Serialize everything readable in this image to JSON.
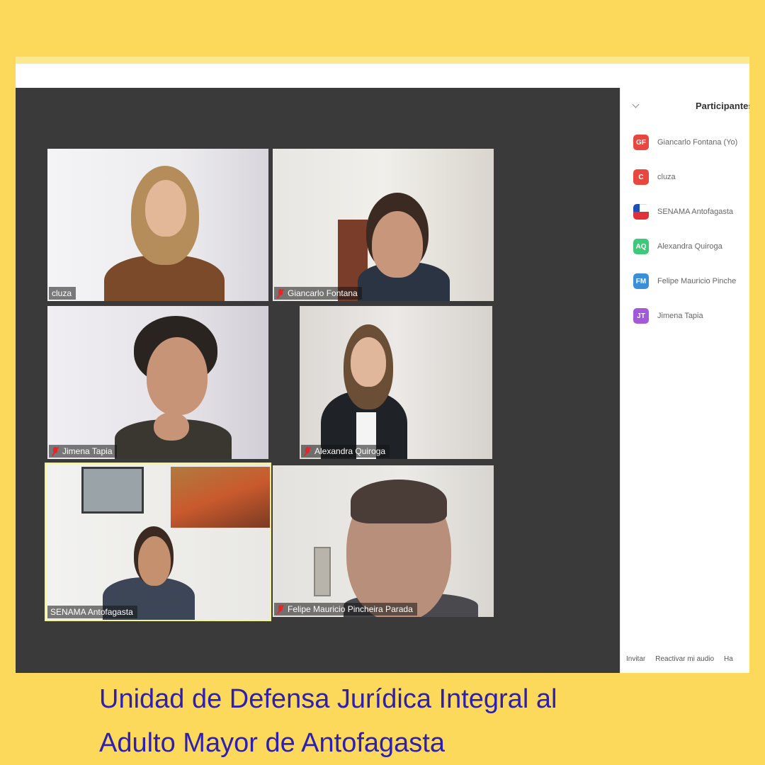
{
  "participants_panel": {
    "title": "Participantes",
    "participants": [
      {
        "initials": "GF",
        "name": "Giancarlo Fontana (Yo)",
        "color": "#e8463f"
      },
      {
        "initials": "C",
        "name": "cluza",
        "color": "#e8463f"
      },
      {
        "initials": "",
        "name": "SENAMA Antofagasta",
        "avatar_icon": "chile-flag-icon"
      },
      {
        "initials": "AQ",
        "name": "Alexandra Quiroga",
        "color": "#3ec97a"
      },
      {
        "initials": "FM",
        "name": "Felipe Mauricio Pinche",
        "color": "#3b8fd9"
      },
      {
        "initials": "JT",
        "name": "Jimena Tapia",
        "color": "#a35ad8"
      }
    ],
    "footer": {
      "invite": "Invitar",
      "unmute": "Reactivar mi audio",
      "more": "Ha"
    }
  },
  "video_tiles": [
    {
      "name": "cluza",
      "muted": false
    },
    {
      "name": "Giancarlo Fontana",
      "muted": true
    },
    {
      "name": "Jimena Tapia",
      "muted": true
    },
    {
      "name": "Alexandra Quiroga",
      "muted": true
    },
    {
      "name": "SENAMA Antofagasta",
      "muted": false
    },
    {
      "name": "Felipe Mauricio Pincheira Parada",
      "muted": true
    }
  ],
  "caption": {
    "line1": "Unidad de Defensa Jurídica Integral al",
    "line2": "Adulto Mayor de Antofagasta"
  },
  "colors": {
    "background": "#fcd95b",
    "caption": "#2e1fb0",
    "video_bg": "#3a3a3a"
  }
}
